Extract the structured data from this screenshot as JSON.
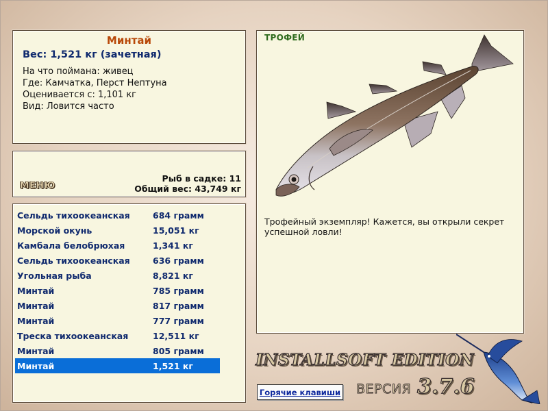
{
  "info": {
    "fish_name": "Минтай",
    "weight": "Вес: 1,521 кг (зачетная)",
    "bait": "На что поймана: живец",
    "location": "Где: Камчатка, Перст Нептуна",
    "valued_from": "Оценивается с: 1,101 кг",
    "type": "Вид: Ловится часто"
  },
  "summary": {
    "menu_label": "МЕНЮ",
    "fish_in_keepnet": "Рыб в садке: 11",
    "total_weight": "Общий вес: 43,749 кг"
  },
  "catch_list": [
    {
      "name": "Сельдь тихоокеанская",
      "weight": "684 грамм"
    },
    {
      "name": "Морской окунь",
      "weight": "15,051 кг"
    },
    {
      "name": "Камбала белобрюхая",
      "weight": "1,341 кг"
    },
    {
      "name": "Сельдь тихоокеанская",
      "weight": "636 грамм"
    },
    {
      "name": "Угольная рыба",
      "weight": "8,821 кг"
    },
    {
      "name": "Минтай",
      "weight": "785 грамм"
    },
    {
      "name": "Минтай",
      "weight": "817 грамм"
    },
    {
      "name": "Минтай",
      "weight": "777 грамм"
    },
    {
      "name": "Треска тихоокеанская",
      "weight": "12,511 кг"
    },
    {
      "name": "Минтай",
      "weight": "805 грамм"
    },
    {
      "name": "Минтай",
      "weight": "1,521 кг"
    }
  ],
  "selected_index": 10,
  "trophy": {
    "label": "ТРОФЕЙ",
    "description": "Трофейный экземпляр! Кажется, вы открыли секрет успешной ловли!",
    "image_icon": "pollock-fish-icon"
  },
  "footer": {
    "brand": "INSTALLSOFT EDITION",
    "hotkeys_label": "Горячие клавиши",
    "version_label": "ВЕРСИЯ",
    "version_number": "3.7.6",
    "logo_icon": "marlin-logo-icon"
  },
  "colors": {
    "selection": "#0a6ed8",
    "fish_name": "#b84808",
    "list_text": "#102a6e",
    "trophy_label": "#2f6b1e"
  }
}
